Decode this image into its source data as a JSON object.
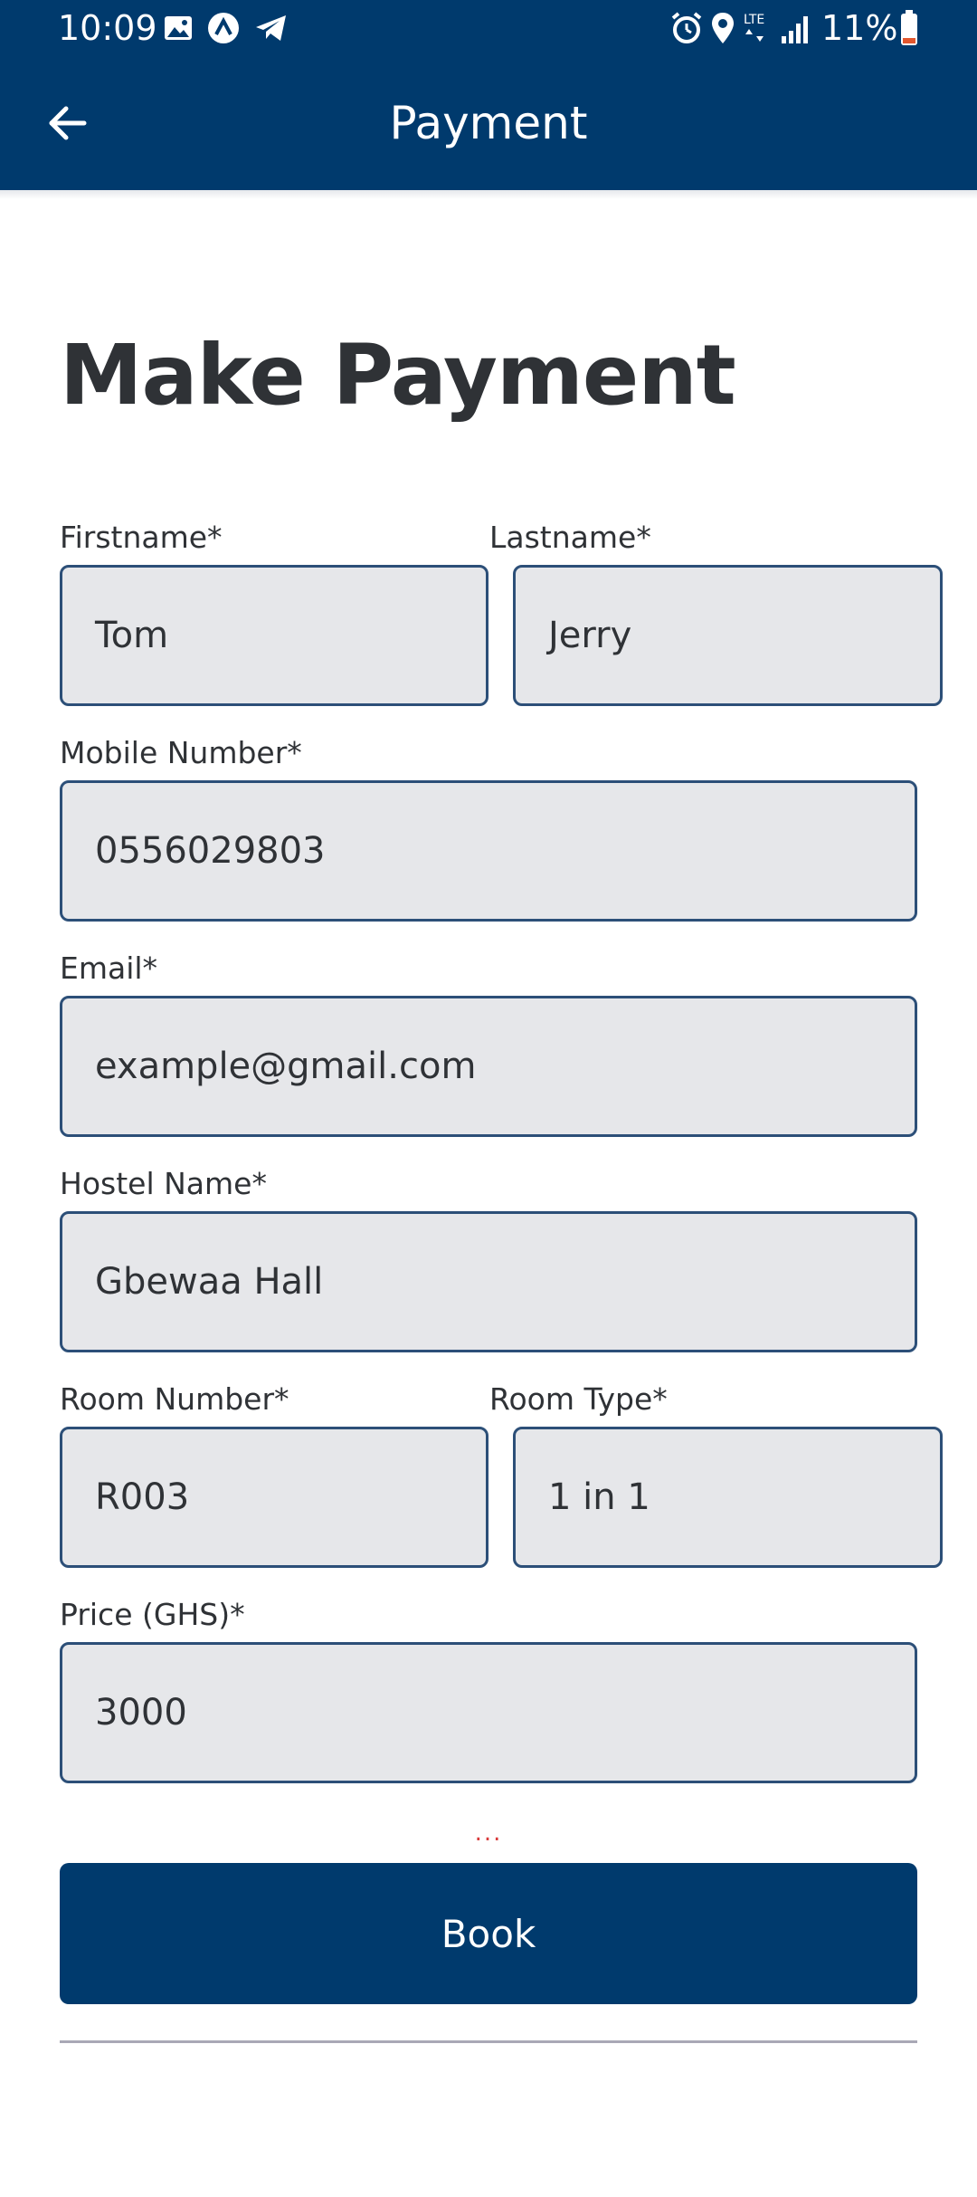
{
  "status_bar": {
    "time": "10:09",
    "battery": "11%",
    "icons": [
      "gallery-icon",
      "app-notification-icon",
      "telegram-icon",
      "alarm-icon",
      "location-icon",
      "lte-icon",
      "signal-icon",
      "battery-icon"
    ],
    "lte": "LTE"
  },
  "app_bar": {
    "title": "Payment",
    "back_icon": "arrow-left-icon"
  },
  "page": {
    "heading": "Make Payment"
  },
  "form": {
    "firstname": {
      "label": "Firstname*",
      "value": "Tom"
    },
    "lastname": {
      "label": "Lastname*",
      "value": "Jerry"
    },
    "mobile": {
      "label": "Mobile Number*",
      "value": "0556029803"
    },
    "email": {
      "label": "Email*",
      "value": "example@gmail.com"
    },
    "hostel": {
      "label": "Hostel Name*",
      "value": "Gbewaa Hall"
    },
    "room_number": {
      "label": "Room Number*",
      "value": "R003"
    },
    "room_type": {
      "label": "Room Type*",
      "value": "1 in 1"
    },
    "price": {
      "label": "Price (GHS)*",
      "value": "3000"
    },
    "error_text": "...",
    "book_label": "Book"
  },
  "colors": {
    "primary": "#003a6d",
    "field_bg": "#e6e7ea",
    "field_border": "#2c4f78",
    "text": "#2f3236",
    "error": "#d93a3a"
  }
}
